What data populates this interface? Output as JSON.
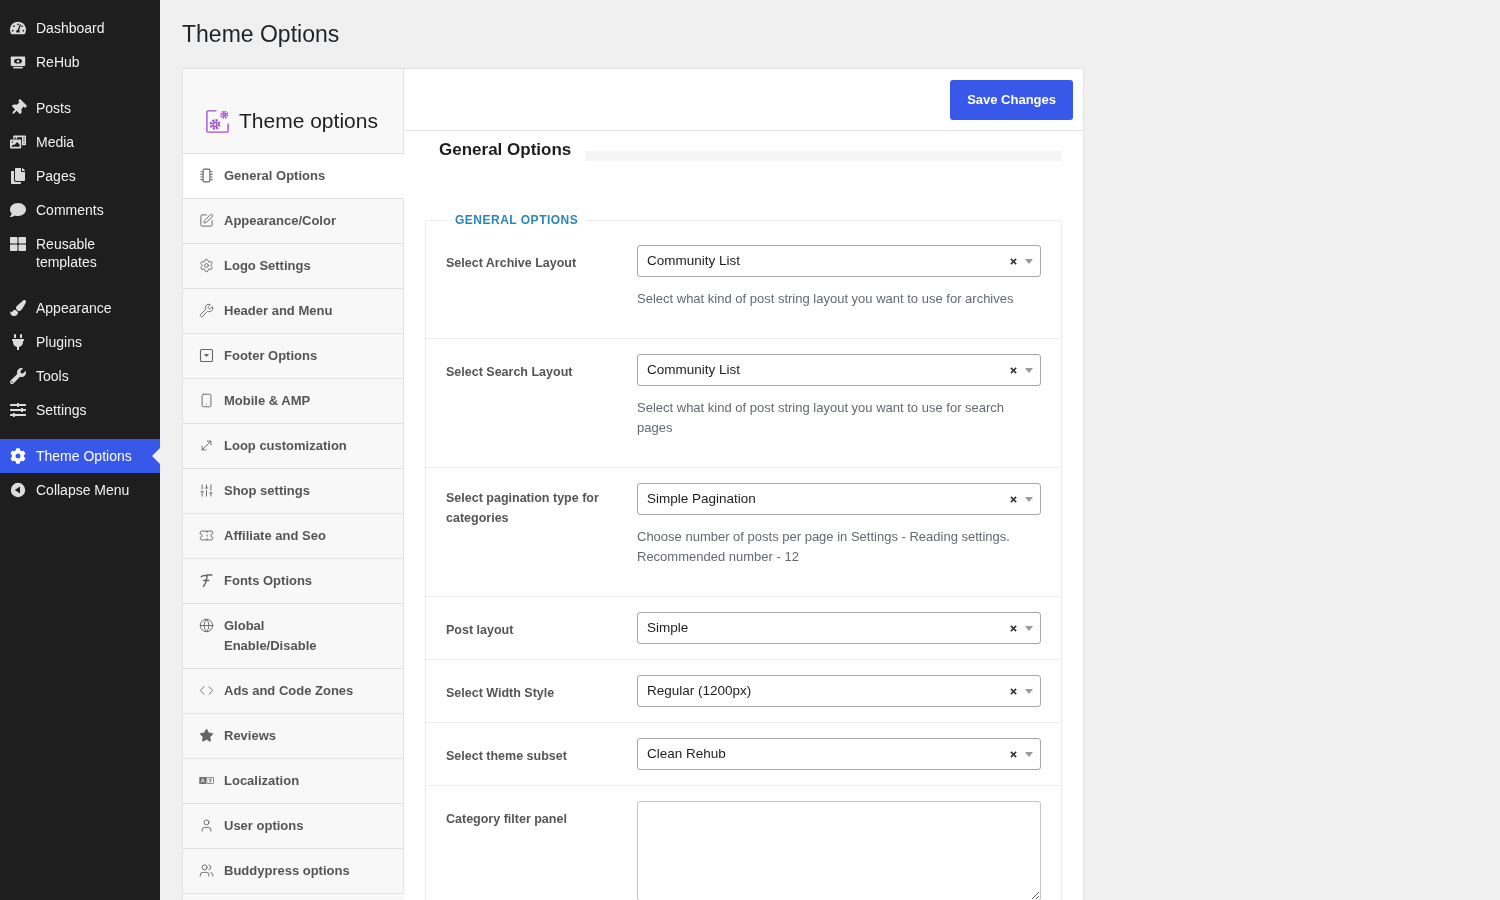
{
  "admin_menu": {
    "groups": [
      {
        "items": [
          {
            "label": "Dashboard",
            "selected": false
          },
          {
            "label": "ReHub",
            "selected": false
          }
        ]
      },
      {
        "items": [
          {
            "label": "Posts",
            "selected": false
          },
          {
            "label": "Media",
            "selected": false
          },
          {
            "label": "Pages",
            "selected": false
          },
          {
            "label": "Comments",
            "selected": false
          },
          {
            "label": "Reusable templates",
            "selected": false
          }
        ]
      },
      {
        "items": [
          {
            "label": "Appearance",
            "selected": false
          },
          {
            "label": "Plugins",
            "selected": false
          },
          {
            "label": "Tools",
            "selected": false
          },
          {
            "label": "Settings",
            "selected": false
          }
        ]
      },
      {
        "items": [
          {
            "label": "Theme Options",
            "selected": true
          }
        ]
      }
    ],
    "collapse_button": {
      "label": "Collapse Menu"
    }
  },
  "page": {
    "title": "Theme Options"
  },
  "options_panel": {
    "logo_title": "Theme options",
    "tabs": [
      {
        "label": "General Options",
        "selected": true
      },
      {
        "label": "Appearance/Color",
        "selected": false
      },
      {
        "label": "Logo Settings",
        "selected": false
      },
      {
        "label": "Header and Menu",
        "selected": false
      },
      {
        "label": "Footer Options",
        "selected": false
      },
      {
        "label": "Mobile & AMP",
        "selected": false
      },
      {
        "label": "Loop customization",
        "selected": false
      },
      {
        "label": "Shop settings",
        "selected": false
      },
      {
        "label": "Affiliate and Seo",
        "selected": false
      },
      {
        "label": "Fonts Options",
        "selected": false
      },
      {
        "label": "Global Enable/Disable",
        "selected": false
      },
      {
        "label": "Ads and Code Zones",
        "selected": false
      },
      {
        "label": "Reviews",
        "selected": false
      },
      {
        "label": "Localization",
        "selected": false
      },
      {
        "label": "User options",
        "selected": false
      },
      {
        "label": "Buddypress options",
        "selected": false
      }
    ],
    "save_button": {
      "label": "Save Changes"
    },
    "section_title": "General Options",
    "fieldset": {
      "legend": "GENERAL OPTIONS",
      "fields": [
        {
          "kind": "select",
          "label": "Select Archive Layout",
          "value": "Community List",
          "description": "Select what kind of post string layout you want to use for archives"
        },
        {
          "kind": "select",
          "label": "Select Search Layout",
          "value": "Community List",
          "description": "Select what kind of post string layout you want to use for search pages"
        },
        {
          "kind": "select",
          "label": "Select pagination type for categories",
          "value": "Simple Pagination",
          "description": "Choose number of posts per page in Settings - Reading settings. Recommended number - 12"
        },
        {
          "kind": "select",
          "label": "Post layout",
          "value": "Simple"
        },
        {
          "kind": "select",
          "label": "Select Width Style",
          "value": "Regular (1200px)"
        },
        {
          "kind": "select",
          "label": "Select theme subset",
          "value": "Clean Rehub"
        },
        {
          "kind": "textarea",
          "label": "Category filter panel"
        }
      ]
    }
  }
}
